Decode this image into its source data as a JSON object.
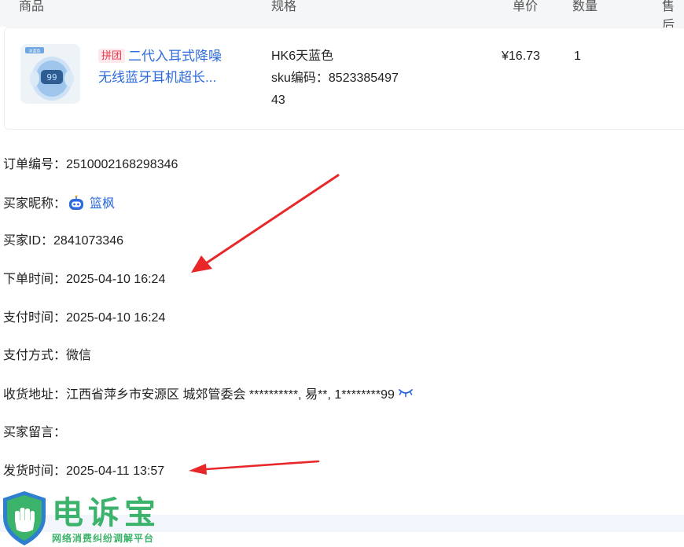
{
  "table_header": {
    "product": "商品",
    "spec": "规格",
    "unit_price": "单价",
    "quantity": "数量",
    "aftersale": "售后"
  },
  "product": {
    "tag": "拼团",
    "title_line1": "二代入耳式降噪",
    "title_line2": "无线蓝牙耳机超长...",
    "spec_name": "HK6天蓝色",
    "sku_label": "sku编码：",
    "sku_part1": "8523385497",
    "sku_part2": "43",
    "price": "¥16.73",
    "qty": "1",
    "thumb_badge": "冰蓝色",
    "thumb_display": "99"
  },
  "order": {
    "order_no_label": "订单编号：",
    "order_no": "2510002168298346",
    "nickname_label": "买家昵称：",
    "nickname": "篮枫",
    "buyer_id_label": "买家ID：",
    "buyer_id": "2841073346",
    "order_time_label": "下单时间：",
    "order_time": "2025-04-10 16:24",
    "pay_time_label": "支付时间：",
    "pay_time": "2025-04-10 16:24",
    "pay_method_label": "支付方式：",
    "pay_method": "微信",
    "address_label": "收货地址：",
    "address": "江西省萍乡市安源区 城郊管委会 **********, 易**, 1********99",
    "note_label": "买家留言：",
    "note": "",
    "ship_time_label": "发货时间：",
    "ship_time": "2025-04-11 13:57"
  },
  "watermark": {
    "name": "电诉宝",
    "sub": "网络消费纠纷调解平台"
  },
  "colors": {
    "link": "#2d6bdc",
    "arrow": "#e8272a",
    "brand_green": "#3bb36a",
    "brand_blue": "#2f7fd0"
  }
}
